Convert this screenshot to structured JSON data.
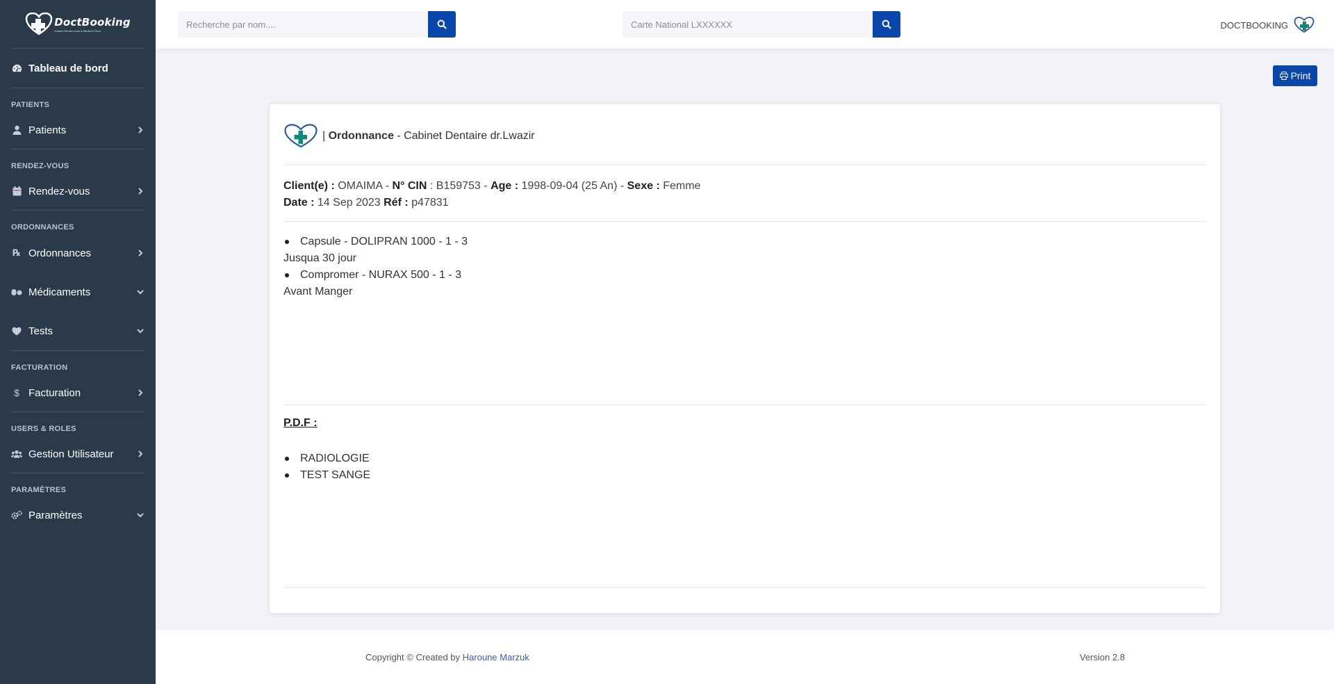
{
  "brand": {
    "name": "DoctBooking",
    "tagline": "Instant Rendez-vous & Medical Client",
    "badge": "PRO"
  },
  "sidebar": {
    "dashboard": "Tableau de bord",
    "sections": {
      "patients": "PATIENTS",
      "rdv": "RENDEZ-VOUS",
      "ordonnances": "ORDONNANCES",
      "facturation": "FACTURATION",
      "users": "USERS & ROLES",
      "params": "PARAMÈTRES"
    },
    "items": {
      "patients": "Patients",
      "rdv": "Rendez-vous",
      "ordonnances": "Ordonnances",
      "medicaments": "Médicaments",
      "tests": "Tests",
      "facturation": "Facturation",
      "users": "Gestion Utilisateur",
      "params": "Paramètres"
    }
  },
  "topbar": {
    "search_name_placeholder": "Recherche par nom....",
    "search_cin_placeholder": "Carte National LXXXXXX",
    "user_name": "DOCTBOOKING"
  },
  "print_label": "Print",
  "ordonnance": {
    "title_sep": "|",
    "title": "Ordonnance",
    "subtitle": "- Cabinet Dentaire dr.Lwazir",
    "client_label": "Client(e) :",
    "client_value": "OMAIMA -",
    "cin_label": "N° CIN",
    "cin_value": ": B159753 -",
    "age_label": "Age :",
    "age_value": "1998-09-04 (25 An) -",
    "sexe_label": "Sexe :",
    "sexe_value": "Femme",
    "date_label": "Date :",
    "date_value": "14 Sep 2023",
    "ref_label": "Réf :",
    "ref_value": "p47831",
    "medicaments": [
      {
        "line": "Capsule - DOLIPRAN 1000 - 1 - 3",
        "note": "Jusqua 30 jour"
      },
      {
        "line": "Compromer - NURAX 500 - 1 - 3",
        "note": "Avant Manger"
      }
    ],
    "pdf_title": "P.D.F :",
    "pdfs": [
      "RADIOLOGIE",
      "TEST SANGE"
    ]
  },
  "footer": {
    "copyright": "Copyright © Created by",
    "author": "Haroune Marzuk",
    "version": "Version 2.8"
  },
  "colors": {
    "sidebar": "#2b3a4a",
    "primary": "#0b47a8",
    "teal": "#0e8a7e",
    "background": "#f0f2f7"
  }
}
